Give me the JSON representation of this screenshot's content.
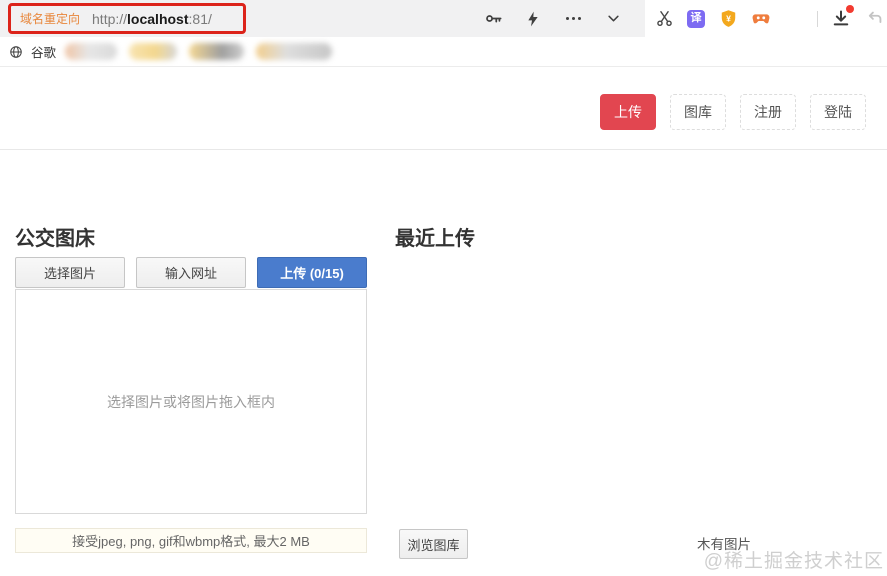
{
  "browser": {
    "address_bar": {
      "redirect_label": "域名重定向",
      "url_prefix": "http://",
      "url_domain": "localhost",
      "url_suffix": ":81/"
    },
    "icons": {
      "translate_glyph": "译",
      "shield_glyph": "¥"
    },
    "bookmarks": {
      "google": "谷歌"
    }
  },
  "page": {
    "nav": {
      "upload": "上传",
      "gallery": "图库",
      "register": "注册",
      "login": "登陆"
    },
    "uploader": {
      "title": "公交图床",
      "choose": "选择图片",
      "enter_url": "输入网址",
      "upload_count": "上传 (0/15)",
      "dropzone_hint": "选择图片或将图片拖入框内",
      "formats": "接受jpeg, png, gif和wbmp格式, 最大2 MB"
    },
    "recent": {
      "title": "最近上传",
      "browse": "浏览图库",
      "empty": "木有图片"
    },
    "watermark": "@稀土掘金技术社区"
  },
  "colors": {
    "accent_red": "#e24650",
    "accent_blue": "#4a7ccd",
    "annotation_red": "#dc231a",
    "redirect_orange": "#e8873c",
    "chrome_gray": "#f1f1f2",
    "translate_purple": "#7d6bf2",
    "shield_gold": "#f3a81d",
    "gamepad_orange": "#ef7d3e"
  }
}
